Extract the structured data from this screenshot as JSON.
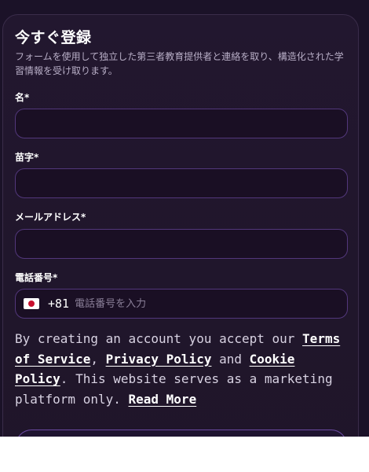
{
  "form": {
    "title": "今すぐ登録",
    "subtitle": "フォームを使用して独立した第三者教育提供者と連絡を取り、構造化された学習情報を受け取ります。",
    "first_name_label": "名*",
    "last_name_label": "苗字*",
    "email_label": "メールアドレス*",
    "phone_label": "電話番号*",
    "phone_country_code": "+81",
    "phone_placeholder": "電話番号を入力",
    "country_flag_icon": "japan-flag-icon"
  },
  "legal": {
    "text_1": "By creating an account you accept our ",
    "terms_link": "Terms of Service",
    "text_2": ", ",
    "privacy_link": "Privacy Policy",
    "text_3": " and ",
    "cookie_link": "Cookie Policy",
    "text_4": ". This website serves as a marketing platform only. ",
    "read_more_link": "Read More"
  },
  "colors": {
    "background": "#1b1228",
    "card": "#22172f",
    "field_border": "#52377b",
    "text": "#ffffff"
  }
}
